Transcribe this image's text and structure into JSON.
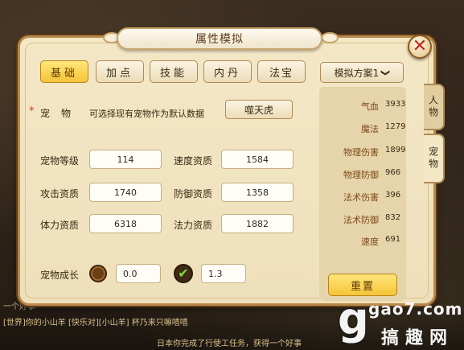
{
  "title": "属性模拟",
  "close_glyph": "✕",
  "tabs": [
    {
      "label": "基础",
      "active": true
    },
    {
      "label": "加点",
      "active": false
    },
    {
      "label": "技能",
      "active": false
    },
    {
      "label": "内丹",
      "active": false
    },
    {
      "label": "法宝",
      "active": false
    }
  ],
  "scheme": {
    "label": "模拟方案1",
    "chevron": "❯"
  },
  "pet": {
    "star": "*",
    "label": "宠物",
    "hint": "可选择现有宠物作为默认数据",
    "selected": "噬天虎"
  },
  "fields": {
    "pet_level": {
      "label": "宠物等级",
      "value": "114"
    },
    "speed_aptitude": {
      "label": "速度资质",
      "value": "1584"
    },
    "attack_aptitude": {
      "label": "攻击资质",
      "value": "1740"
    },
    "defense_aptitude": {
      "label": "防御资质",
      "value": "1358"
    },
    "stamina_aptitude": {
      "label": "体力资质",
      "value": "6318"
    },
    "magic_aptitude": {
      "label": "法力资质",
      "value": "1882"
    }
  },
  "growth": {
    "label": "宠物成长",
    "option1_value": "0.0",
    "option2_value": "1.3",
    "check_glyph": "✔",
    "selected_option": 2
  },
  "stats": [
    {
      "label": "气血",
      "value": "3933"
    },
    {
      "label": "魔法",
      "value": "1279"
    },
    {
      "label": "物理伤害",
      "value": "1899"
    },
    {
      "label": "物理防御",
      "value": "966"
    },
    {
      "label": "法术伤害",
      "value": "396"
    },
    {
      "label": "法术防御",
      "value": "832"
    },
    {
      "label": "速度",
      "value": "691"
    }
  ],
  "reset_label": "重置",
  "side_tabs": {
    "person": "人物",
    "pet": "宠物"
  },
  "background_chat": [
    "一个好事",
    "[世界]你的小山羊 [快乐对][小山羊] 杯乃来只嘛嘻嘻",
    "日本你完成了行使工任务，获得一个好事"
  ],
  "watermark": {
    "glyph": "g",
    "url": "gao7.com",
    "name": "搞趣网"
  },
  "colors": {
    "panel_bg": "#f3e7c6",
    "tab_active": "#f6c437",
    "border": "#b9894a",
    "close_x": "#c0281a"
  }
}
